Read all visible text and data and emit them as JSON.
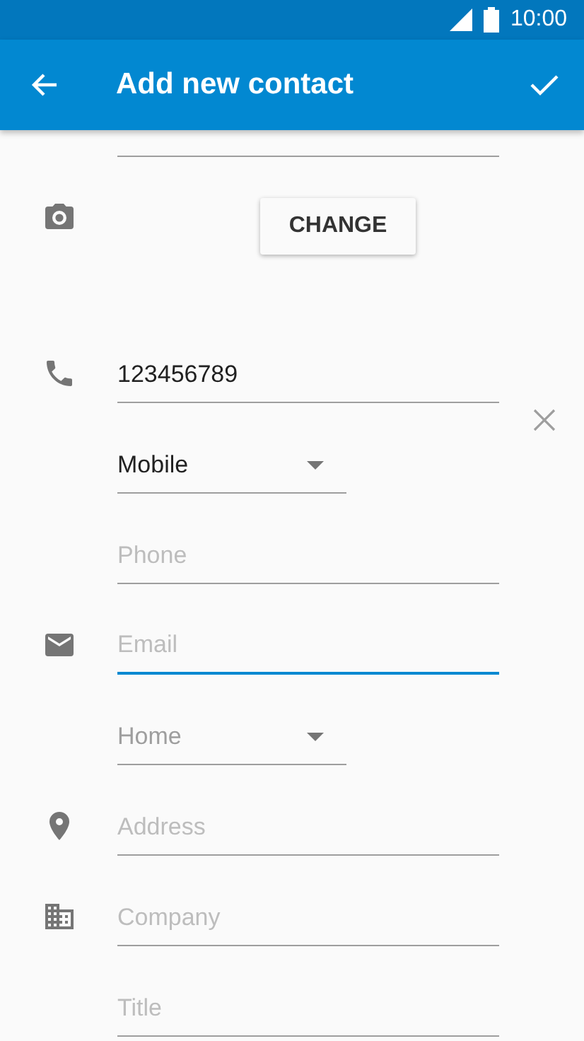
{
  "status_bar": {
    "time": "10:00"
  },
  "app_bar": {
    "title": "Add new contact"
  },
  "sections": [
    {
      "kind": "photo",
      "button": "CHANGE"
    },
    {
      "kind": "phone",
      "removable": true,
      "fields": [
        {
          "kind": "text",
          "value": "123456789",
          "focused": false
        },
        {
          "kind": "dropdown",
          "value": "Mobile",
          "disabled": false
        },
        {
          "kind": "text",
          "placeholder": "Phone",
          "focused": false
        }
      ]
    },
    {
      "kind": "email",
      "fields": [
        {
          "kind": "text",
          "placeholder": "Email",
          "focused": true
        },
        {
          "kind": "dropdown",
          "value": "Home",
          "disabled": true
        }
      ]
    },
    {
      "kind": "address",
      "fields": [
        {
          "kind": "text",
          "placeholder": "Address",
          "focused": false
        }
      ]
    },
    {
      "kind": "company",
      "fields": [
        {
          "kind": "text",
          "placeholder": "Company",
          "focused": false
        },
        {
          "kind": "text",
          "placeholder": "Title",
          "focused": false
        }
      ]
    }
  ]
}
